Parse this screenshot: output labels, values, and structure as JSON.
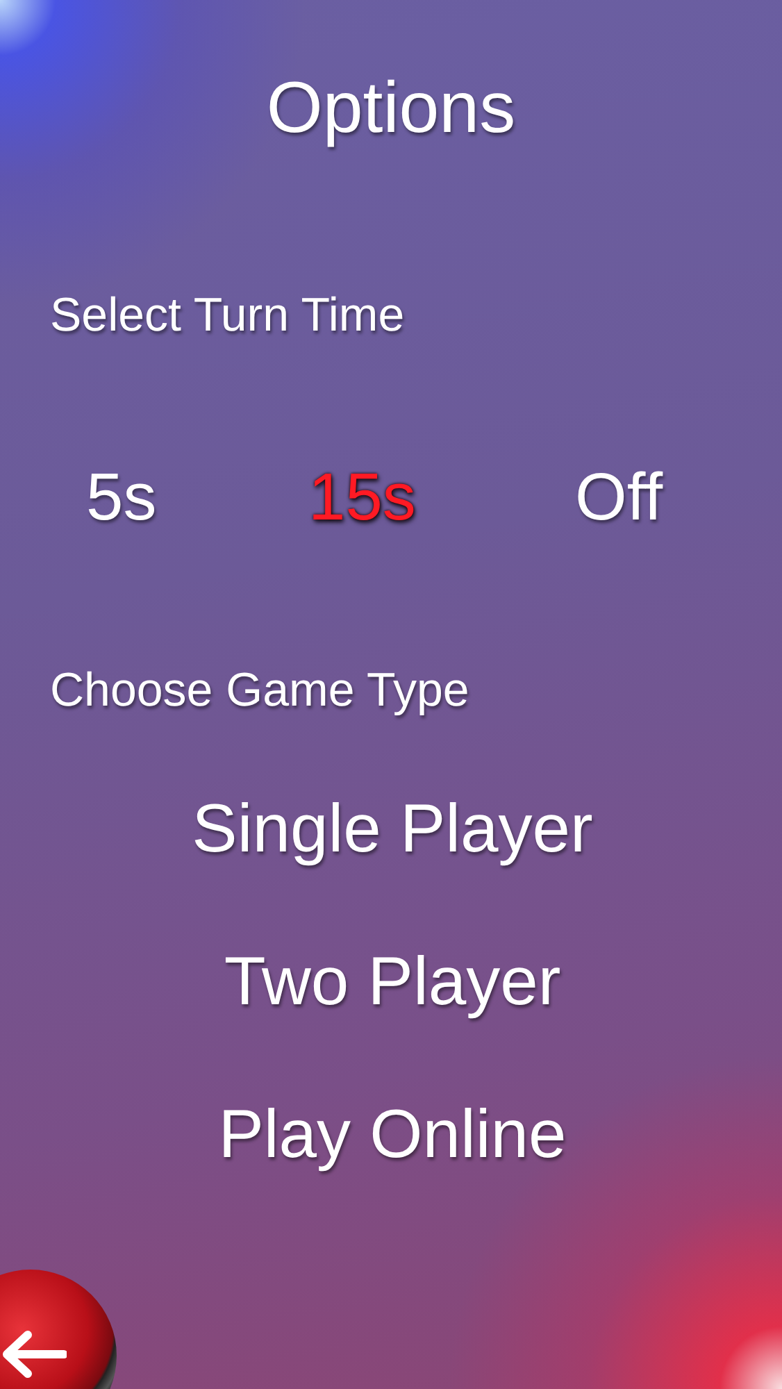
{
  "title": "Options",
  "turn_time": {
    "label": "Select Turn Time",
    "options": [
      {
        "label": "5s",
        "selected": false
      },
      {
        "label": "15s",
        "selected": true
      },
      {
        "label": "Off",
        "selected": false
      }
    ]
  },
  "game_type": {
    "label": "Choose Game Type",
    "buttons": [
      "Single Player",
      "Two Player",
      "Play Online"
    ]
  }
}
